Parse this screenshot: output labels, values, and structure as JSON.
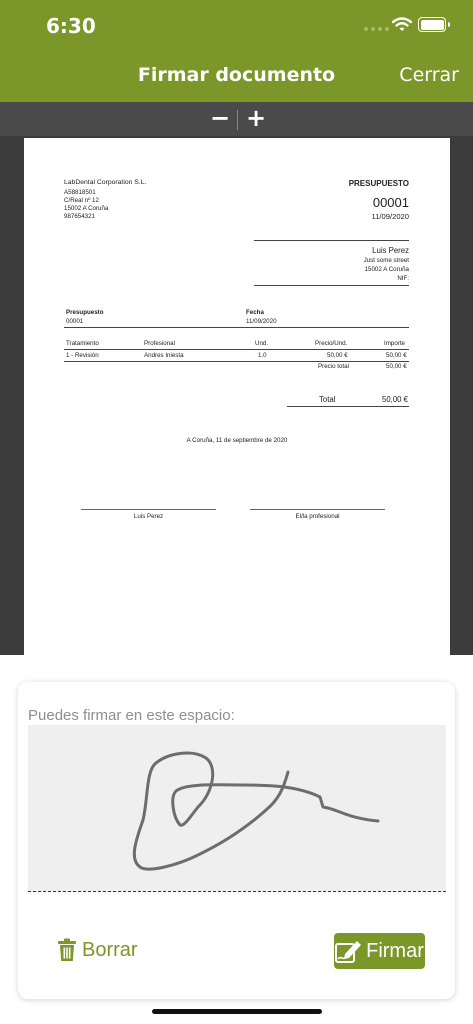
{
  "status_bar": {
    "time": "6:30"
  },
  "nav": {
    "title": "Firmar documento",
    "close_label": "Cerrar"
  },
  "zoom": {
    "minus_label": "−",
    "plus_label": "+"
  },
  "document": {
    "company": {
      "name": "LabDental Corporation S.L.",
      "cif": "A58818501",
      "address": "C/Real nº 12",
      "city": "15002 A Coruña",
      "phone": "987654321"
    },
    "doc_type": "PRESUPUESTO",
    "doc_number": "00001",
    "doc_date": "11/09/2020",
    "client": {
      "name": "Luis Perez",
      "street": "Just some street",
      "city": "15002 A Coruña",
      "nif": "NIF:"
    },
    "meta_headers": {
      "presupuesto": "Presupuesto",
      "fecha": "Fecha"
    },
    "meta_values": {
      "presupuesto": "00001",
      "fecha": "11/09/2020"
    },
    "table": {
      "headers": [
        "Tratamiento",
        "Profesional",
        "Und.",
        "Precio/Und.",
        "Importe"
      ],
      "rows": [
        [
          "1 - Revisión",
          "Andres Iniesta",
          "1.0",
          "50,00 €",
          "50,00 €"
        ]
      ]
    },
    "precio_total_label": "Precio total",
    "precio_total_value": "50,00 €",
    "total_label": "Total",
    "total_value": "50,00 €",
    "place_date": "A Coruña, 11 de septiembre de 2020",
    "signature_left": "Luis Perez",
    "signature_right": "El/la profesional"
  },
  "sign_panel": {
    "label": "Puedes firmar en este espacio:",
    "clear_label": "Borrar",
    "sign_label": "Firmar"
  },
  "colors": {
    "accent": "#7b9629",
    "viewer_bg": "#3b3b3b"
  },
  "icons": {
    "clear": "trash-icon",
    "sign": "signature-pen-icon"
  }
}
